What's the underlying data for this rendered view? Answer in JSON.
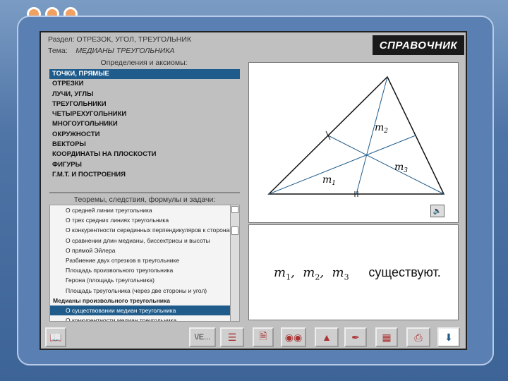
{
  "header": {
    "section_label": "Раздел:",
    "section_value": "ОТРЕЗОК, УГОЛ, ТРЕУГОЛЬНИК",
    "topic_label": "Тема:",
    "topic_value": "МЕДИАНЫ ТРЕУГОЛЬНИКА",
    "app_title": "СПРАВОЧНИК"
  },
  "definitions": {
    "title": "Определения и аксиомы:",
    "items": [
      "ТОЧКИ, ПРЯМЫЕ",
      "ОТРЕЗКИ",
      "ЛУЧИ, УГЛЫ",
      "ТРЕУГОЛЬНИКИ",
      "ЧЕТЫРЕХУГОЛЬНИКИ",
      "МНОГОУГОЛЬНИКИ",
      "ОКРУЖНОСТИ",
      "ВЕКТОРЫ",
      "КООРДИНАТЫ НА ПЛОСКОСТИ",
      "ФИГУРЫ",
      "Г.М.Т. И ПОСТРОЕНИЯ"
    ],
    "selected": 0
  },
  "theorems": {
    "title": "Теоремы, следствия, формулы и задачи:",
    "items": [
      {
        "text": "О средней линии треугольника",
        "type": "item"
      },
      {
        "text": "О трех средних линиях треугольника",
        "type": "item"
      },
      {
        "text": "О конкурентности серединных перпендикуляров к сторонам",
        "type": "item"
      },
      {
        "text": "О сравнении длин медианы, биссектрисы и высоты",
        "type": "item"
      },
      {
        "text": "О прямой Эйлера",
        "type": "item"
      },
      {
        "text": "Разбиение двух отрезков в треугольнике",
        "type": "item"
      },
      {
        "text": "Площадь произвольного треугольника",
        "type": "item"
      },
      {
        "text": "Герона (площадь треугольника)",
        "type": "item"
      },
      {
        "text": "Площадь треугольника (через две стороны и угол)",
        "type": "item"
      },
      {
        "text": "Медианы произвольного треугольника",
        "type": "head"
      },
      {
        "text": "О существовании медиан треугольника",
        "type": "sel"
      },
      {
        "text": "О конкурентности медиан треугольника",
        "type": "item"
      }
    ]
  },
  "figure": {
    "labels": {
      "m2": "m",
      "m2_sub": "2",
      "m3": "m",
      "m3_sub": "3",
      "m1": "m",
      "m1_sub": "1"
    }
  },
  "statement": {
    "m1": "m",
    "m1_sub": "1",
    "m2": "m",
    "m2_sub": "2",
    "m3": "m",
    "m3_sub": "3",
    "comma": ",",
    "text": "существуют."
  },
  "toolbar": {
    "buttons": [
      "book-icon",
      "list-icon",
      "sliders-icon",
      "document-icon",
      "binoculars-icon",
      "chart-icon",
      "ruler-icon",
      "table-icon",
      "printer-icon",
      "exit-icon"
    ],
    "list_label": "\\/Е..."
  },
  "colors": {
    "selection": "#1f5c8c",
    "title_bg": "#1a1a1a"
  }
}
